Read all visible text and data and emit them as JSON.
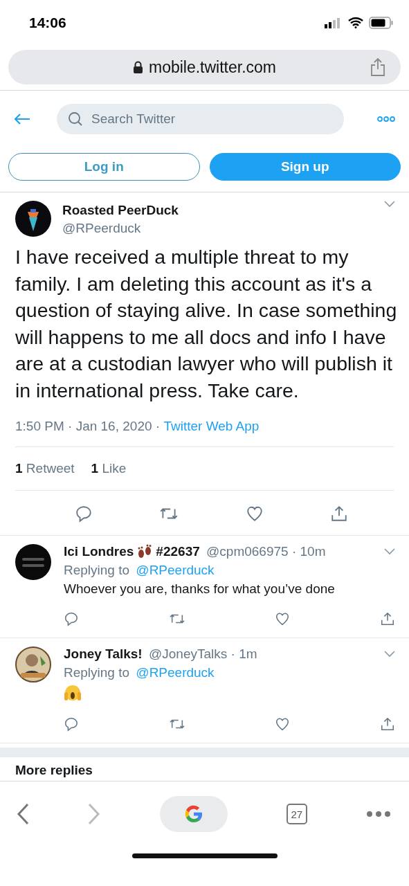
{
  "status_bar": {
    "time": "14:06"
  },
  "browser": {
    "url": "mobile.twitter.com"
  },
  "nav": {
    "search": {
      "placeholder": "Search Twitter"
    }
  },
  "auth_buttons": [
    {
      "label": "Log in",
      "kind": "outline"
    },
    {
      "label": "Sign up",
      "kind": "filled"
    }
  ],
  "tweet": {
    "name": "Roasted PeerDuck",
    "handle": "@RPeerduck",
    "text": "I have received a multiple threat to my family. I am deleting this account as it's a question of staying alive. In case something will happens to me all docs and info I have are at a custodian lawyer who will publish it in international press. Take care.",
    "time": "1:50 PM · Jan 16, 2020 · ",
    "source": "Twitter Web App",
    "stats": [
      {
        "count": "1",
        "label": "Retweet"
      },
      {
        "count": "1",
        "label": "Like"
      }
    ]
  },
  "replies": [
    {
      "name": "Ici Londres",
      "badge": "#22637",
      "name_icon": true,
      "handle": "@cpm066975 · 10m",
      "replying_prefix": "Replying to ",
      "replying_to": "@RPeerduck",
      "text": "Whoever you are, thanks for what you’ve done",
      "emoji": false
    },
    {
      "name": "Joney Talks!",
      "handle": "@JoneyTalks · 1m",
      "replying_prefix": "Replying to ",
      "replying_to": "@RPeerduck",
      "emoji": true
    }
  ],
  "more_replies": {
    "title": "More replies"
  },
  "toolbar": {
    "tabs_count": "27"
  }
}
